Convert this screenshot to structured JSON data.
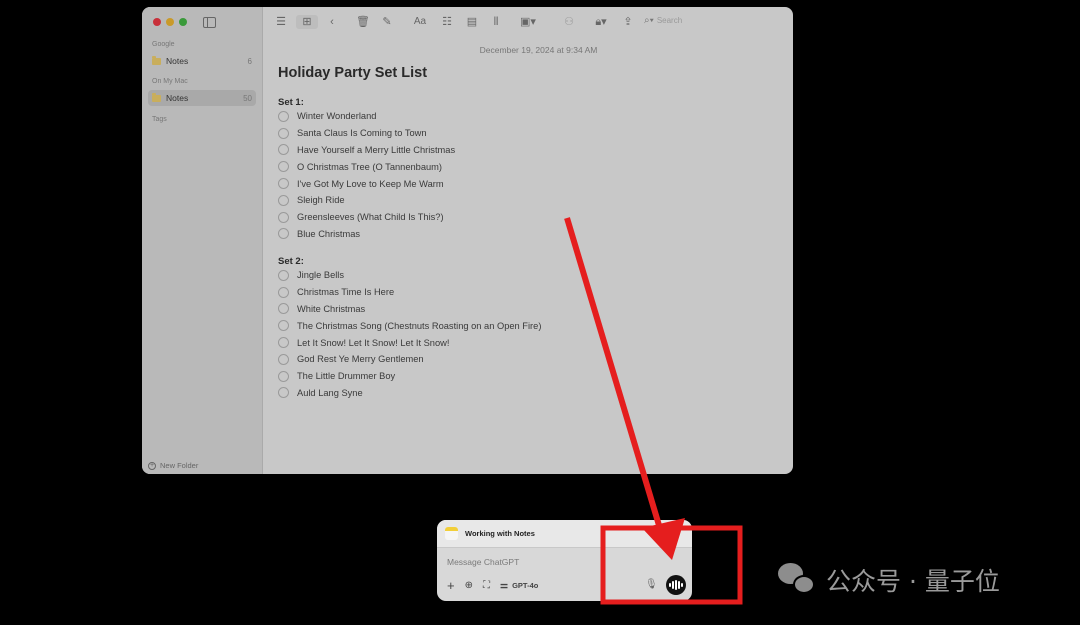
{
  "notes_window": {
    "sidebar": {
      "sections": [
        {
          "label": "Google",
          "items": [
            {
              "label": "Notes",
              "count": "6",
              "selected": false
            }
          ]
        },
        {
          "label": "On My Mac",
          "items": [
            {
              "label": "Notes",
              "count": "50",
              "selected": true
            }
          ]
        }
      ],
      "tags_label": "Tags",
      "new_folder_label": "New Folder"
    },
    "toolbar": {
      "icons": [
        "list-view-icon",
        "gallery-view-icon",
        "back-icon",
        "trash-icon",
        "compose-icon",
        "format-icon",
        "checklist-icon",
        "table-icon",
        "audio-icon",
        "media-icon",
        "collaborate-icon",
        "lock-icon",
        "share-icon",
        "search-icon"
      ],
      "search_placeholder": "Search"
    },
    "note": {
      "date": "December 19, 2024 at 9:34 AM",
      "title": "Holiday Party Set List",
      "sets": [
        {
          "label": "Set 1:",
          "items": [
            "Winter Wonderland",
            "Santa Claus Is Coming to Town",
            "Have Yourself a Merry Little Christmas",
            "O Christmas Tree (O Tannenbaum)",
            "I've Got My Love to Keep Me Warm",
            "Sleigh Ride",
            "Greensleeves (What Child Is This?)",
            "Blue Christmas"
          ]
        },
        {
          "label": "Set 2:",
          "items": [
            "Jingle Bells",
            "Christmas Time Is Here",
            "White Christmas",
            "The Christmas Song (Chestnuts Roasting on an Open Fire)",
            "Let It Snow! Let It Snow! Let It Snow!",
            "God Rest Ye Merry Gentlemen",
            "The Little Drummer Boy",
            "Auld Lang Syne"
          ]
        }
      ]
    }
  },
  "chat_popup": {
    "title": "Working with Notes",
    "input_placeholder": "Message ChatGPT",
    "model_label": "GPT-4o",
    "tools": [
      "plus-icon",
      "globe-icon",
      "screenshot-icon",
      "settings-sliders-icon"
    ]
  },
  "annotation": {
    "color": "#e51e1e"
  },
  "watermark": {
    "text": "公众号 · 量子位"
  }
}
